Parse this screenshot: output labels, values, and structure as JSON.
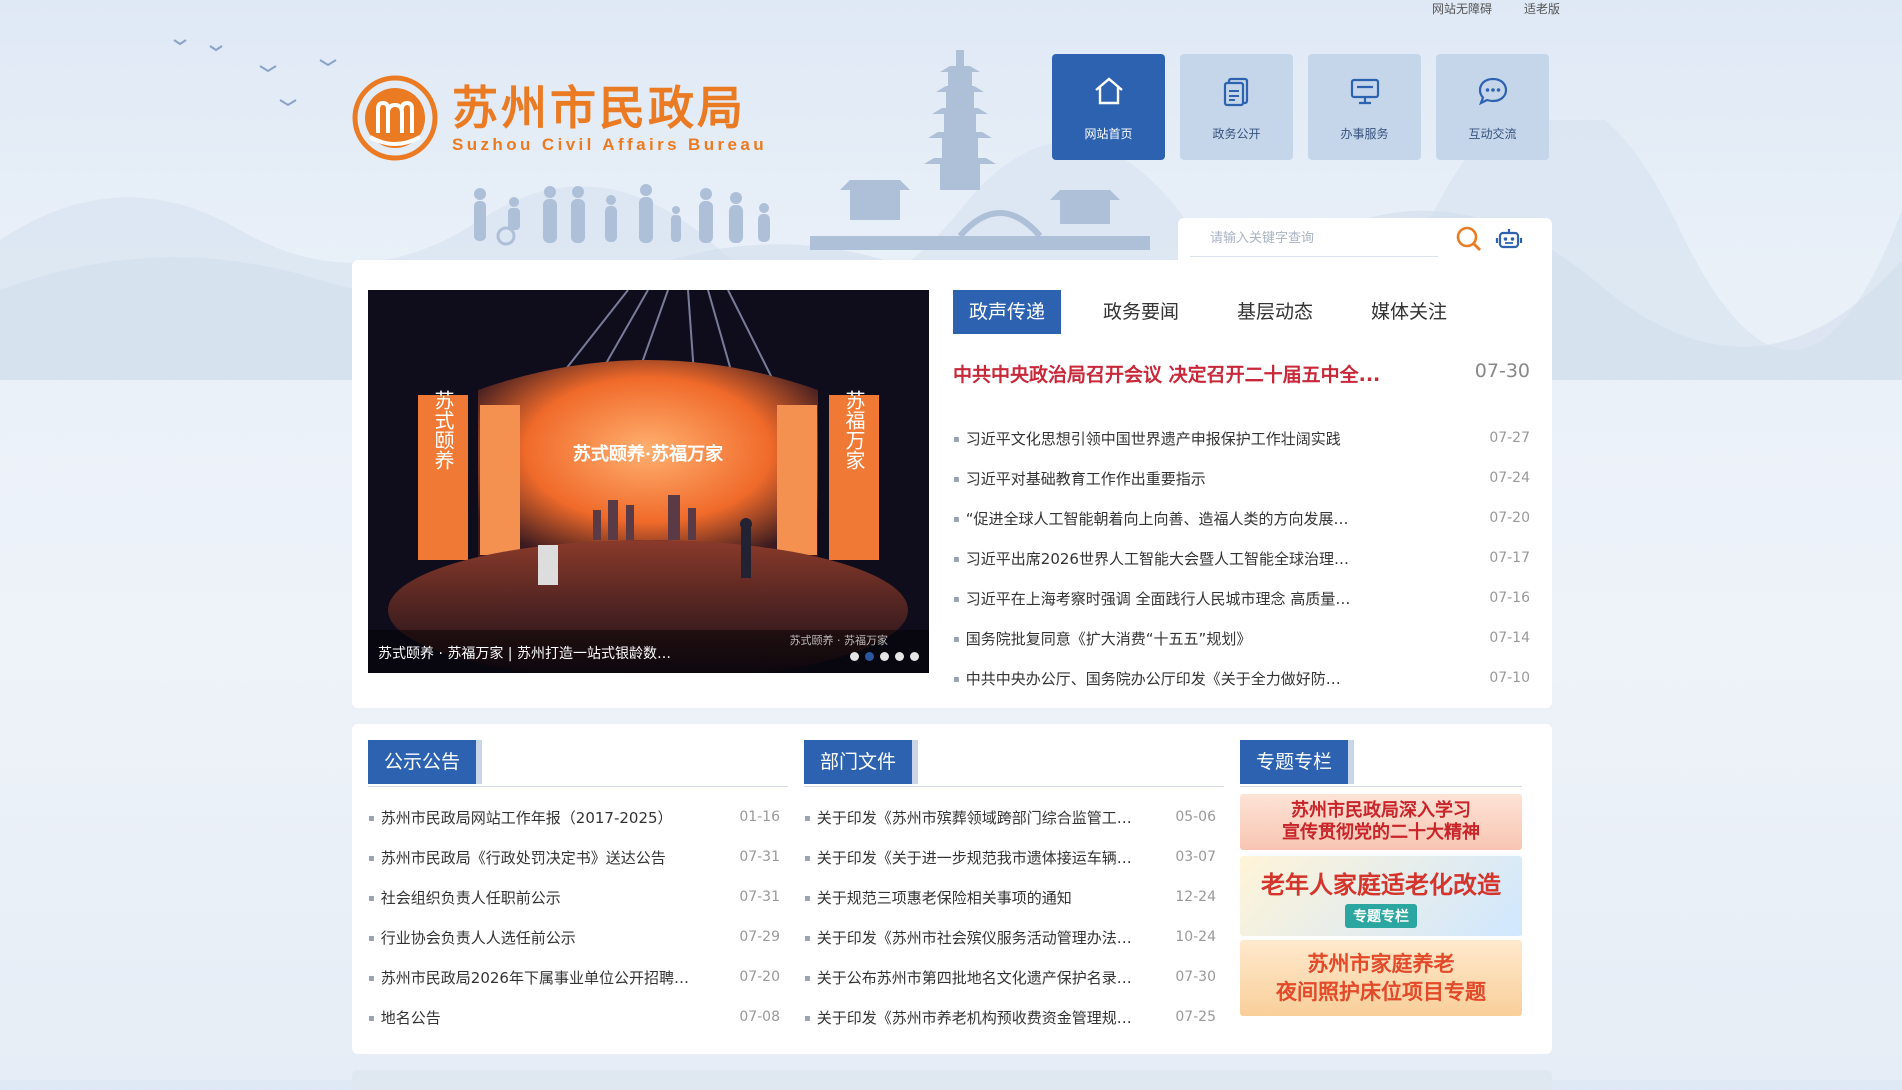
{
  "top_links": [
    "网站无障碍",
    "适老版"
  ],
  "logo": {
    "cn": "苏州市民政局",
    "en": "Suzhou Civil Affairs Bureau"
  },
  "nav": [
    {
      "label": "网站首页",
      "icon": "home-icon",
      "active": true
    },
    {
      "label": "政务公开",
      "icon": "document-icon",
      "active": false
    },
    {
      "label": "办事服务",
      "icon": "monitor-icon",
      "active": false
    },
    {
      "label": "互动交流",
      "icon": "chat-icon",
      "active": false
    }
  ],
  "search": {
    "placeholder": "请输入关键字查询"
  },
  "slider": {
    "caption": "苏式颐养 · 苏福万家 | 苏州打造一站式银龄数…",
    "stage_title": "苏式颐养·苏福万家",
    "side_text_left": "苏式颐养",
    "side_text_right": "苏福万家",
    "watermark": "苏式颐养 · 苏福万家",
    "dots": 5,
    "active_dot": 2
  },
  "news_tabs": [
    "政声传递",
    "政务要闻",
    "基层动态",
    "媒体关注"
  ],
  "headline": {
    "title": "中共中央政治局召开会议 决定召开二十届五中全...",
    "date": "07-30"
  },
  "news": [
    {
      "title": "习近平文化思想引领中国世界遗产申报保护工作壮阔实践",
      "date": "07-27"
    },
    {
      "title": "习近平对基础教育工作作出重要指示",
      "date": "07-24"
    },
    {
      "title": "“促进全球人工智能朝着向上向善、造福人类的方向发展…",
      "date": "07-20"
    },
    {
      "title": "习近平出席2026世界人工智能大会暨人工智能全球治理…",
      "date": "07-17"
    },
    {
      "title": "习近平在上海考察时强调 全面践行人民城市理念 高质量…",
      "date": "07-16"
    },
    {
      "title": "国务院批复同意《扩大消费“十五五”规划》",
      "date": "07-14"
    },
    {
      "title": "中共中央办公厅、国务院办公厅印发《关于全力做好防…",
      "date": "07-10"
    }
  ],
  "notices": {
    "title": "公示公告",
    "items": [
      {
        "title": "苏州市民政局网站工作年报（2017-2025）",
        "date": "01-16"
      },
      {
        "title": "苏州市民政局《行政处罚决定书》送达公告",
        "date": "07-31"
      },
      {
        "title": "社会组织负责人任职前公示",
        "date": "07-31"
      },
      {
        "title": "行业协会负责人人选任前公示",
        "date": "07-29"
      },
      {
        "title": "苏州市民政局2026年下属事业单位公开招聘…",
        "date": "07-20"
      },
      {
        "title": "地名公告",
        "date": "07-08"
      }
    ]
  },
  "documents": {
    "title": "部门文件",
    "items": [
      {
        "title": "关于印发《苏州市殡葬领域跨部门综合监管工…",
        "date": "05-06"
      },
      {
        "title": "关于印发《关于进一步规范我市遗体接运车辆…",
        "date": "03-07"
      },
      {
        "title": "关于规范三项惠老保险相关事项的通知",
        "date": "12-24"
      },
      {
        "title": "关于印发《苏州市社会殡仪服务活动管理办法…",
        "date": "10-24"
      },
      {
        "title": "关于公布苏州市第四批地名文化遗产保护名录…",
        "date": "07-30"
      },
      {
        "title": "关于印发《苏州市养老机构预收费资金管理规…",
        "date": "07-25"
      }
    ]
  },
  "topics": {
    "title": "专题专栏",
    "banner1": {
      "line1": "苏州市民政局深入学习",
      "line2": "宣传贯彻党的二十大精神"
    },
    "banner2": {
      "line1": "老年人家庭适老化改造",
      "tag": "专题专栏"
    },
    "banner3": {
      "line1": "苏州市家庭养老",
      "line2": "夜间照护床位项目专题"
    }
  },
  "colors": {
    "brand_blue": "#2d62b1",
    "logo_orange": "#ea7b22",
    "headline_red": "#c8283a"
  }
}
